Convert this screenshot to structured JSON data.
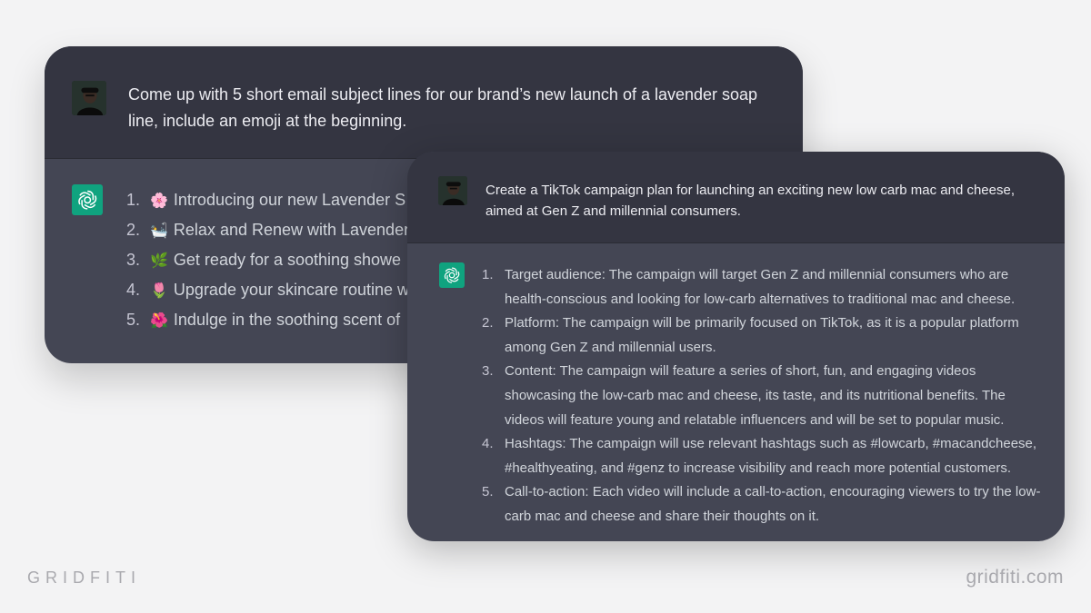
{
  "card_back": {
    "prompt": "Come up with 5 short email subject lines for our brand’s new launch of a lavender soap line, include an emoji at the beginning.",
    "items": [
      {
        "num": "1.",
        "emoji": "🌸",
        "text": "Introducing our new Lavender S"
      },
      {
        "num": "2.",
        "emoji": "🛀",
        "text": "Relax and Renew with Lavender"
      },
      {
        "num": "3.",
        "emoji": "🌿",
        "text": "Get ready for a soothing showe"
      },
      {
        "num": "4.",
        "emoji": "🌷",
        "text": "Upgrade your skincare routine w"
      },
      {
        "num": "5.",
        "emoji": "🌺",
        "text": "Indulge in the soothing scent of"
      }
    ]
  },
  "card_front": {
    "prompt": "Create a TikTok campaign plan for launching an exciting new low carb mac and cheese, aimed at Gen Z and millennial consumers.",
    "items": [
      {
        "num": "1.",
        "text": "Target audience: The campaign will target Gen Z and millennial consumers who are health-conscious and looking for low-carb alternatives to traditional mac and cheese."
      },
      {
        "num": "2.",
        "text": "Platform: The campaign will be primarily focused on TikTok, as it is a popular platform among Gen Z and millennial users."
      },
      {
        "num": "3.",
        "text": "Content: The campaign will feature a series of short, fun, and engaging videos showcasing the low-carb mac and cheese, its taste, and its nutritional benefits. The videos will feature young and relatable influencers and will be set to popular music."
      },
      {
        "num": "4.",
        "text": "Hashtags: The campaign will use relevant hashtags such as #lowcarb, #macandcheese, #healthyeating, and #genz to increase visibility and reach more potential customers."
      },
      {
        "num": "5.",
        "text": "Call-to-action: Each video will include a call-to-action, encouraging viewers to try the low-carb mac and cheese and share their thoughts on it."
      }
    ]
  },
  "watermark": {
    "left": "GRIDFITI",
    "right": "gridfiti.com"
  },
  "colors": {
    "background": "#f3f3f4",
    "user_row": "#343541",
    "assistant_row": "#444654",
    "gpt_logo": "#10a37f"
  },
  "icons": {
    "user_avatar": "user-avatar-icon",
    "assistant": "openai-logo-icon"
  }
}
